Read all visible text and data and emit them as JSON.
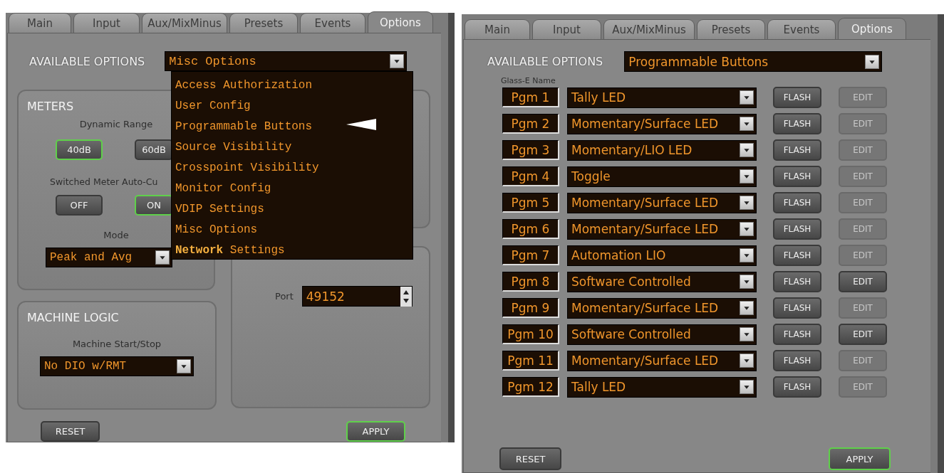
{
  "left_panel": {
    "tabs": [
      {
        "label": "Main",
        "selected": false
      },
      {
        "label": "Input",
        "selected": false
      },
      {
        "label": "Aux/MixMinus",
        "selected": false
      },
      {
        "label": "Presets",
        "selected": false
      },
      {
        "label": "Events",
        "selected": false
      },
      {
        "label": "Options",
        "selected": true
      }
    ],
    "available_options": {
      "label": "AVAILABLE OPTIONS",
      "value": "Misc Options"
    },
    "meters": {
      "title": "METERS",
      "dynamic_range": {
        "label": "Dynamic Range",
        "options": [
          {
            "label": "40dB",
            "selected": true
          },
          {
            "label": "60dB",
            "selected": false
          }
        ]
      },
      "auto_cue": {
        "label": "Switched Meter Auto-Cu",
        "options": [
          {
            "label": "OFF",
            "selected": false
          },
          {
            "label": "ON",
            "selected": true
          }
        ]
      },
      "mode": {
        "label": "Mode",
        "value": "Peak and Avg"
      }
    },
    "machine_logic": {
      "title": "MACHINE LOGIC",
      "start_stop": {
        "label": "Machine Start/Stop",
        "value": "No DIO w/RMT"
      }
    },
    "port": {
      "label": "Port",
      "value": "49152"
    },
    "options_menu": [
      {
        "label": "Access Authorization"
      },
      {
        "label": "User Config"
      },
      {
        "label": "Programmable Buttons"
      },
      {
        "label": "Source Visibility"
      },
      {
        "label": "Crosspoint Visibility"
      },
      {
        "label": "Monitor Config"
      },
      {
        "label": "VDIP Settings"
      },
      {
        "label": "Misc Options"
      },
      {
        "label": "**Network** Settings"
      }
    ],
    "buttons": [
      {
        "label": "RESET",
        "highlighted": false
      },
      {
        "label": "APPLY",
        "highlighted": true
      }
    ]
  },
  "right_panel": {
    "tabs": [
      {
        "label": "Main",
        "selected": false
      },
      {
        "label": "Input",
        "selected": false
      },
      {
        "label": "Aux/MixMinus",
        "selected": false
      },
      {
        "label": "Presets",
        "selected": false
      },
      {
        "label": "Events",
        "selected": false
      },
      {
        "label": "Options",
        "selected": true
      }
    ],
    "available_options": {
      "label": "AVAILABLE OPTIONS",
      "value": "Programmable Buttons"
    },
    "name_header": "Glass-E Name",
    "rows": [
      {
        "name": "Pgm 1",
        "mode": "Tally LED",
        "flash": "FLASH",
        "edit": "EDIT",
        "edit_enabled": false
      },
      {
        "name": "Pgm 2",
        "mode": "Momentary/Surface LED",
        "flash": "FLASH",
        "edit": "EDIT",
        "edit_enabled": false
      },
      {
        "name": "Pgm 3",
        "mode": "Momentary/LIO LED",
        "flash": "FLASH",
        "edit": "EDIT",
        "edit_enabled": false
      },
      {
        "name": "Pgm 4",
        "mode": "Toggle",
        "flash": "FLASH",
        "edit": "EDIT",
        "edit_enabled": false
      },
      {
        "name": "Pgm 5",
        "mode": "Momentary/Surface LED",
        "flash": "FLASH",
        "edit": "EDIT",
        "edit_enabled": false
      },
      {
        "name": "Pgm 6",
        "mode": "Momentary/Surface LED",
        "flash": "FLASH",
        "edit": "EDIT",
        "edit_enabled": false
      },
      {
        "name": "Pgm 7",
        "mode": "Automation LIO",
        "flash": "FLASH",
        "edit": "EDIT",
        "edit_enabled": false
      },
      {
        "name": "Pgm 8",
        "mode": "Software Controlled",
        "flash": "FLASH",
        "edit": "EDIT",
        "edit_enabled": true
      },
      {
        "name": "Pgm 9",
        "mode": "Momentary/Surface LED",
        "flash": "FLASH",
        "edit": "EDIT",
        "edit_enabled": false
      },
      {
        "name": "Pgm 10",
        "mode": "Software Controlled",
        "flash": "FLASH",
        "edit": "EDIT",
        "edit_enabled": true
      },
      {
        "name": "Pgm 11",
        "mode": "Momentary/Surface LED",
        "flash": "FLASH",
        "edit": "EDIT",
        "edit_enabled": false
      },
      {
        "name": "Pgm 12",
        "mode": "Tally LED",
        "flash": "FLASH",
        "edit": "EDIT",
        "edit_enabled": false
      }
    ],
    "buttons": [
      {
        "label": "RESET",
        "highlighted": false
      },
      {
        "label": "APPLY",
        "highlighted": true
      }
    ]
  }
}
